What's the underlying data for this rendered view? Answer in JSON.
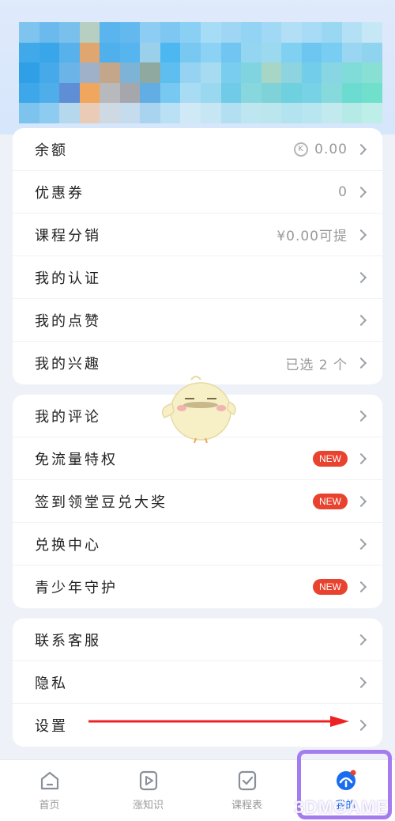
{
  "menu_group_1": [
    {
      "label": "余额",
      "value": "0.00",
      "coin": "K"
    },
    {
      "label": "优惠券",
      "value": "0"
    },
    {
      "label": "课程分销",
      "value": "¥0.00可提"
    },
    {
      "label": "我的认证",
      "value": ""
    },
    {
      "label": "我的点赞",
      "value": ""
    },
    {
      "label": "我的兴趣",
      "value": "已选 2 个"
    }
  ],
  "menu_group_2": [
    {
      "label": "我的评论",
      "badge": ""
    },
    {
      "label": "免流量特权",
      "badge": "NEW"
    },
    {
      "label": "签到领堂豆兑大奖",
      "badge": "NEW"
    },
    {
      "label": "兑换中心",
      "badge": ""
    },
    {
      "label": "青少年守护",
      "badge": "NEW"
    }
  ],
  "menu_group_3": [
    {
      "label": "联系客服"
    },
    {
      "label": "隐私"
    },
    {
      "label": "设置"
    }
  ],
  "tabbar": [
    {
      "label": "首页",
      "icon": "home-icon"
    },
    {
      "label": "涨知识",
      "icon": "play-icon"
    },
    {
      "label": "课程表",
      "icon": "checklist-icon"
    },
    {
      "label": "我的",
      "icon": "profile-icon",
      "active": true
    }
  ],
  "watermark": "3DMGAME",
  "colors": {
    "accent": "#1a6cf0",
    "badge": "#e8432e",
    "highlight": "#a57bf0",
    "arrow": "#ee2222"
  }
}
